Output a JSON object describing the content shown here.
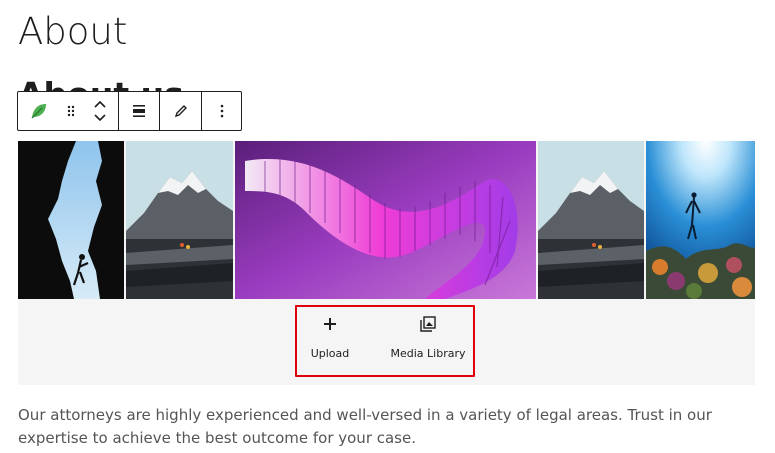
{
  "page": {
    "title": "About",
    "block_heading": "About us"
  },
  "toolbar": {
    "items": [
      {
        "icon": "leaf-icon",
        "color": "#4caf50"
      },
      {
        "icon": "drag-handle-icon"
      },
      {
        "icon": "move-up-icon"
      },
      {
        "icon": "move-down-icon"
      },
      {
        "icon": "align-icon"
      },
      {
        "icon": "pencil-icon"
      },
      {
        "icon": "more-options-icon"
      }
    ]
  },
  "gallery": {
    "images": [
      {
        "subject": "climber silhouette against blue sky"
      },
      {
        "subject": "snowy mountain over black sand beach"
      },
      {
        "subject": "purple abstract 3d ribbon"
      },
      {
        "subject": "snowy mountain over black sand beach"
      },
      {
        "subject": "diver in underwater coral reef"
      }
    ],
    "actions": {
      "upload_label": "Upload",
      "media_library_label": "Media Library"
    },
    "highlight_color": "#e0000b"
  },
  "content": {
    "paragraph": "Our attorneys are highly experienced and well-versed in a variety of legal areas. Trust in our expertise to achieve the best outcome for your case."
  }
}
